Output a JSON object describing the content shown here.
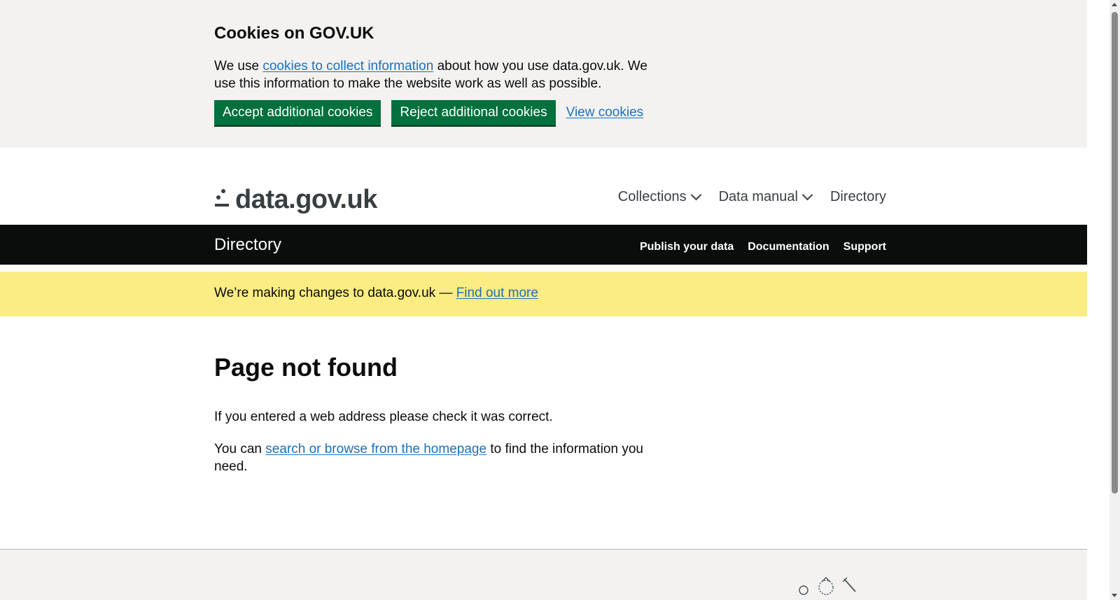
{
  "cookie_banner": {
    "title": "Cookies on GOV.UK",
    "text_before": "We use ",
    "link_text": "cookies to collect information",
    "text_after": " about how you use data.gov.uk. We use this information to make the website work as well as possible.",
    "accept_label": "Accept additional cookies",
    "reject_label": "Reject additional cookies",
    "view_label": "View cookies"
  },
  "header": {
    "logo_text": "data.gov.uk",
    "nav": [
      {
        "label": "Collections"
      },
      {
        "label": "Data manual"
      },
      {
        "label": "Directory"
      }
    ]
  },
  "section_bar": {
    "title": "Directory",
    "links": [
      "Publish your data",
      "Documentation",
      "Support"
    ]
  },
  "notice": {
    "text": "We’re making changes to data.gov.uk — ",
    "link_text": "Find out more"
  },
  "main": {
    "heading": "Page not found",
    "p1": "If you entered a web address please check it was correct.",
    "p2_before": "You can ",
    "p2_link": "search or browse from the homepage",
    "p2_after": " to find the information you need."
  },
  "colors": {
    "button_green": "#00703c",
    "link_blue": "#1d70b8",
    "notice_yellow": "#fbec83",
    "bar_black": "#0b0c0c",
    "banner_grey": "#f3f2f1"
  }
}
